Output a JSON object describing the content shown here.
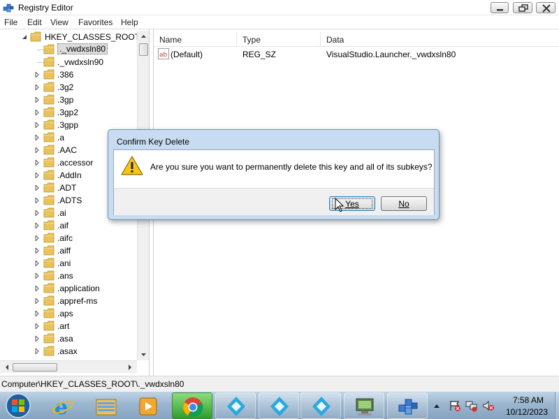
{
  "window": {
    "title": "Registry Editor",
    "icon": "regedit-icon"
  },
  "menu": [
    "File",
    "Edit",
    "View",
    "Favorites",
    "Help"
  ],
  "tree": {
    "root": "HKEY_CLASSES_ROOT",
    "items": [
      {
        "label": "._vwdxsln80",
        "selected": true
      },
      {
        "label": "._vwdxsln90"
      },
      {
        "label": ".386"
      },
      {
        "label": ".3g2"
      },
      {
        "label": ".3gp"
      },
      {
        "label": ".3gp2"
      },
      {
        "label": ".3gpp"
      },
      {
        "label": ".a"
      },
      {
        "label": ".AAC"
      },
      {
        "label": ".accessor"
      },
      {
        "label": ".AddIn"
      },
      {
        "label": ".ADT"
      },
      {
        "label": ".ADTS"
      },
      {
        "label": ".ai"
      },
      {
        "label": ".aif"
      },
      {
        "label": ".aifc"
      },
      {
        "label": ".aiff"
      },
      {
        "label": ".ani"
      },
      {
        "label": ".ans"
      },
      {
        "label": ".application"
      },
      {
        "label": ".appref-ms"
      },
      {
        "label": ".aps"
      },
      {
        "label": ".art"
      },
      {
        "label": ".asa"
      },
      {
        "label": ".asax"
      }
    ]
  },
  "list": {
    "columns": [
      "Name",
      "Type",
      "Data"
    ],
    "rows": [
      {
        "name": "(Default)",
        "type": "REG_SZ",
        "data": "VisualStudio.Launcher._vwdxsln80"
      }
    ]
  },
  "status": {
    "path": "Computer\\HKEY_CLASSES_ROOT\\._vwdxsln80"
  },
  "dialog": {
    "title": "Confirm Key Delete",
    "message": "Are you sure you want to permanently delete this key and all of its subkeys?",
    "yes_label": "Yes",
    "no_label": "No"
  },
  "taskbar": {
    "buttons": [
      "start-orb",
      "internet-explorer-icon",
      "file-explorer-icon",
      "media-player-icon",
      "chrome-icon",
      "kodi-icon",
      "kodi-icon",
      "kodi-icon",
      "network-computer-icon",
      "regedit-icon"
    ],
    "time": "7:58 AM",
    "date": "10/12/2023"
  },
  "colors": {
    "dialog_frame": "#c7dcf0",
    "taskbar": "#9bb6cf",
    "active_task": "#2f9d2a",
    "folder": "#e8c25a",
    "warning": "#f5c518"
  }
}
